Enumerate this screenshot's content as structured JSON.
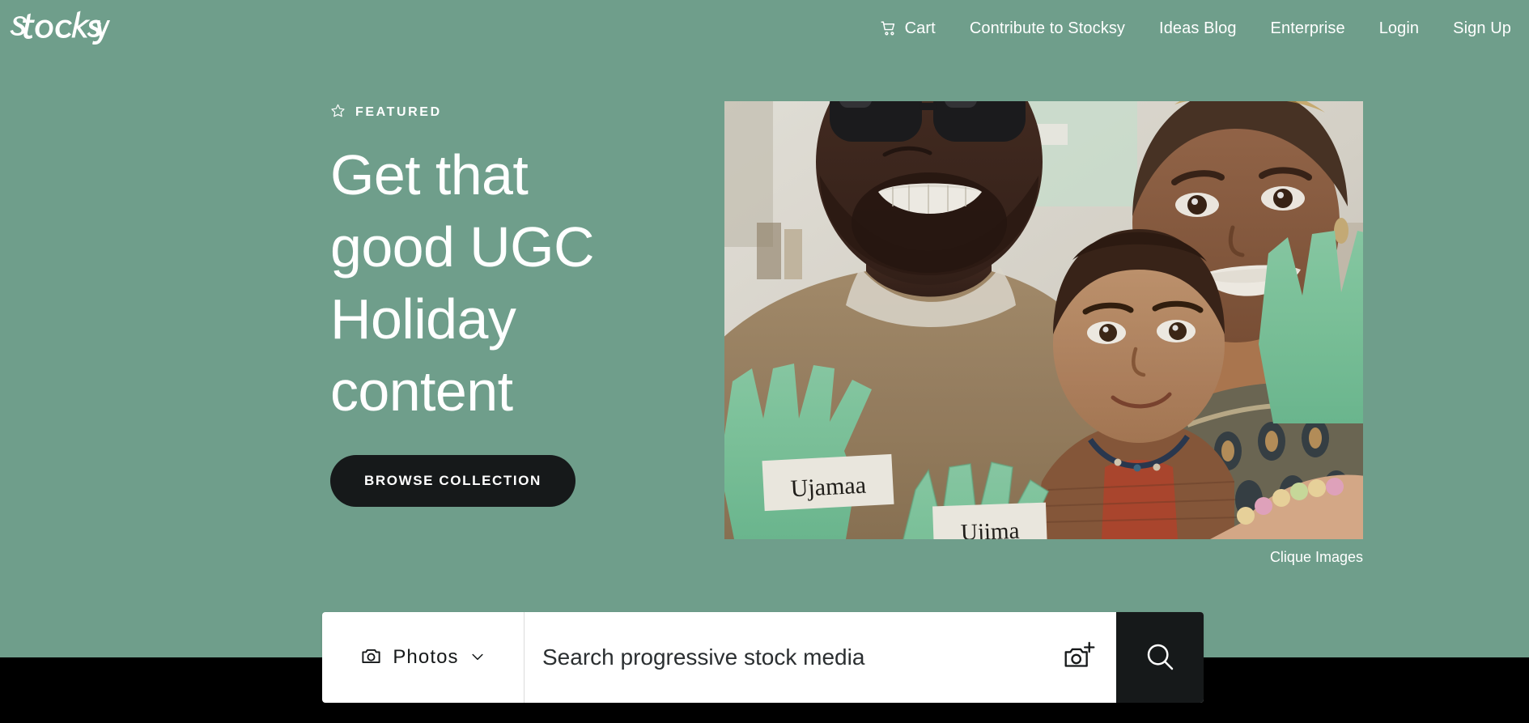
{
  "site": {
    "brand_name": "Stocksy",
    "background_color": "#6f9e8b",
    "accent_dark": "#16191a"
  },
  "header": {
    "nav_items": [
      {
        "label": "Cart",
        "icon": "shopping-cart-icon"
      },
      {
        "label": "Contribute to Stocksy",
        "icon": ""
      },
      {
        "label": "Ideas Blog",
        "icon": ""
      },
      {
        "label": "Enterprise",
        "icon": ""
      },
      {
        "label": "Login",
        "icon": ""
      },
      {
        "label": "Sign Up",
        "icon": ""
      }
    ]
  },
  "hero": {
    "eyebrow": "FEATURED",
    "eyebrow_icon": "star-outline-icon",
    "headline": "Get that good UGC Holiday content",
    "cta_label": "BROWSE COLLECTION",
    "photo_credit": "Clique Images",
    "image_alt": "Family smiling at camera holding green paper hand cutouts labeled Ujamaa and Ujima",
    "image_note_1": "Ujamaa",
    "image_note_2": "Ujima"
  },
  "search": {
    "media_type_label": "Photos",
    "media_type_icon": "camera-icon",
    "media_type_chevron": "chevron-down-icon",
    "placeholder": "Search progressive stock media",
    "visual_search_icon": "camera-plus-icon",
    "submit_icon": "search-icon",
    "visual_search_label": "Visual search",
    "submit_label": "Search"
  }
}
